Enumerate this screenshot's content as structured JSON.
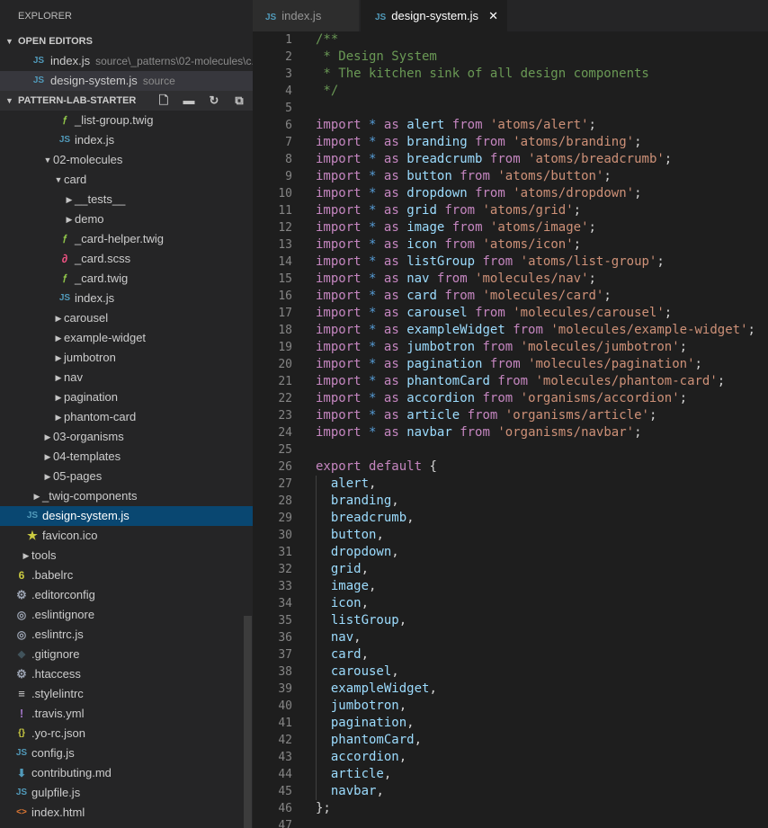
{
  "sidebar": {
    "title": "EXPLORER",
    "open_editors_label": "OPEN EDITORS",
    "open_editors": [
      {
        "icon": "JS",
        "name": "index.js",
        "path": "source\\_patterns\\02-molecules\\c..."
      },
      {
        "icon": "JS",
        "name": "design-system.js",
        "path": "source"
      }
    ],
    "project_label": "PATTERN-LAB-STARTER",
    "tree": [
      {
        "name": "_list-group.twig",
        "type": "twig",
        "depth": 4
      },
      {
        "name": "index.js",
        "type": "js",
        "depth": 4
      },
      {
        "name": "02-molecules",
        "type": "folder-open",
        "depth": 2
      },
      {
        "name": "card",
        "type": "folder-open",
        "depth": 3
      },
      {
        "name": "__tests__",
        "type": "folder",
        "depth": 4
      },
      {
        "name": "demo",
        "type": "folder",
        "depth": 4
      },
      {
        "name": "_card-helper.twig",
        "type": "twig",
        "depth": 4
      },
      {
        "name": "_card.scss",
        "type": "scss",
        "depth": 4
      },
      {
        "name": "_card.twig",
        "type": "twig",
        "depth": 4
      },
      {
        "name": "index.js",
        "type": "js",
        "depth": 4
      },
      {
        "name": "carousel",
        "type": "folder",
        "depth": 3
      },
      {
        "name": "example-widget",
        "type": "folder",
        "depth": 3
      },
      {
        "name": "jumbotron",
        "type": "folder",
        "depth": 3
      },
      {
        "name": "nav",
        "type": "folder",
        "depth": 3
      },
      {
        "name": "pagination",
        "type": "folder",
        "depth": 3
      },
      {
        "name": "phantom-card",
        "type": "folder",
        "depth": 3
      },
      {
        "name": "03-organisms",
        "type": "folder",
        "depth": 2
      },
      {
        "name": "04-templates",
        "type": "folder",
        "depth": 2
      },
      {
        "name": "05-pages",
        "type": "folder",
        "depth": 2
      },
      {
        "name": "_twig-components",
        "type": "folder",
        "depth": 1
      },
      {
        "name": "design-system.js",
        "type": "js",
        "depth": 1,
        "selected": true
      },
      {
        "name": "favicon.ico",
        "type": "star",
        "depth": 1
      },
      {
        "name": "tools",
        "type": "folder",
        "depth": 0
      },
      {
        "name": ".babelrc",
        "type": "babel",
        "depth": 0
      },
      {
        "name": ".editorconfig",
        "type": "gear",
        "depth": 0
      },
      {
        "name": ".eslintignore",
        "type": "eslint",
        "depth": 0
      },
      {
        "name": ".eslintrc.js",
        "type": "eslint",
        "depth": 0
      },
      {
        "name": ".gitignore",
        "type": "git",
        "depth": 0
      },
      {
        "name": ".htaccess",
        "type": "gear",
        "depth": 0
      },
      {
        "name": ".stylelintrc",
        "type": "lines",
        "depth": 0
      },
      {
        "name": ".travis.yml",
        "type": "yml",
        "depth": 0
      },
      {
        "name": ".yo-rc.json",
        "type": "json",
        "depth": 0
      },
      {
        "name": "config.js",
        "type": "js",
        "depth": 0
      },
      {
        "name": "contributing.md",
        "type": "md",
        "depth": 0
      },
      {
        "name": "gulpfile.js",
        "type": "js",
        "depth": 0
      },
      {
        "name": "index.html",
        "type": "html",
        "depth": 0
      }
    ]
  },
  "tabs": [
    {
      "icon": "JS",
      "label": "index.js"
    },
    {
      "icon": "JS",
      "label": "design-system.js",
      "active": true
    }
  ],
  "code": [
    [
      [
        "c",
        "/**"
      ]
    ],
    [
      [
        "c",
        " * Design System"
      ]
    ],
    [
      [
        "c",
        " * The kitchen sink of all design components"
      ]
    ],
    [
      [
        "c",
        " */"
      ]
    ],
    [],
    [
      [
        "k",
        "import"
      ],
      [
        "p",
        " "
      ],
      [
        "b",
        "*"
      ],
      [
        "p",
        " "
      ],
      [
        "k",
        "as"
      ],
      [
        "p",
        " "
      ],
      [
        "v",
        "alert"
      ],
      [
        "p",
        " "
      ],
      [
        "k",
        "from"
      ],
      [
        "p",
        " "
      ],
      [
        "s",
        "'atoms/alert'"
      ],
      [
        "p",
        ";"
      ]
    ],
    [
      [
        "k",
        "import"
      ],
      [
        "p",
        " "
      ],
      [
        "b",
        "*"
      ],
      [
        "p",
        " "
      ],
      [
        "k",
        "as"
      ],
      [
        "p",
        " "
      ],
      [
        "v",
        "branding"
      ],
      [
        "p",
        " "
      ],
      [
        "k",
        "from"
      ],
      [
        "p",
        " "
      ],
      [
        "s",
        "'atoms/branding'"
      ],
      [
        "p",
        ";"
      ]
    ],
    [
      [
        "k",
        "import"
      ],
      [
        "p",
        " "
      ],
      [
        "b",
        "*"
      ],
      [
        "p",
        " "
      ],
      [
        "k",
        "as"
      ],
      [
        "p",
        " "
      ],
      [
        "v",
        "breadcrumb"
      ],
      [
        "p",
        " "
      ],
      [
        "k",
        "from"
      ],
      [
        "p",
        " "
      ],
      [
        "s",
        "'atoms/breadcrumb'"
      ],
      [
        "p",
        ";"
      ]
    ],
    [
      [
        "k",
        "import"
      ],
      [
        "p",
        " "
      ],
      [
        "b",
        "*"
      ],
      [
        "p",
        " "
      ],
      [
        "k",
        "as"
      ],
      [
        "p",
        " "
      ],
      [
        "v",
        "button"
      ],
      [
        "p",
        " "
      ],
      [
        "k",
        "from"
      ],
      [
        "p",
        " "
      ],
      [
        "s",
        "'atoms/button'"
      ],
      [
        "p",
        ";"
      ]
    ],
    [
      [
        "k",
        "import"
      ],
      [
        "p",
        " "
      ],
      [
        "b",
        "*"
      ],
      [
        "p",
        " "
      ],
      [
        "k",
        "as"
      ],
      [
        "p",
        " "
      ],
      [
        "v",
        "dropdown"
      ],
      [
        "p",
        " "
      ],
      [
        "k",
        "from"
      ],
      [
        "p",
        " "
      ],
      [
        "s",
        "'atoms/dropdown'"
      ],
      [
        "p",
        ";"
      ]
    ],
    [
      [
        "k",
        "import"
      ],
      [
        "p",
        " "
      ],
      [
        "b",
        "*"
      ],
      [
        "p",
        " "
      ],
      [
        "k",
        "as"
      ],
      [
        "p",
        " "
      ],
      [
        "v",
        "grid"
      ],
      [
        "p",
        " "
      ],
      [
        "k",
        "from"
      ],
      [
        "p",
        " "
      ],
      [
        "s",
        "'atoms/grid'"
      ],
      [
        "p",
        ";"
      ]
    ],
    [
      [
        "k",
        "import"
      ],
      [
        "p",
        " "
      ],
      [
        "b",
        "*"
      ],
      [
        "p",
        " "
      ],
      [
        "k",
        "as"
      ],
      [
        "p",
        " "
      ],
      [
        "v",
        "image"
      ],
      [
        "p",
        " "
      ],
      [
        "k",
        "from"
      ],
      [
        "p",
        " "
      ],
      [
        "s",
        "'atoms/image'"
      ],
      [
        "p",
        ";"
      ]
    ],
    [
      [
        "k",
        "import"
      ],
      [
        "p",
        " "
      ],
      [
        "b",
        "*"
      ],
      [
        "p",
        " "
      ],
      [
        "k",
        "as"
      ],
      [
        "p",
        " "
      ],
      [
        "v",
        "icon"
      ],
      [
        "p",
        " "
      ],
      [
        "k",
        "from"
      ],
      [
        "p",
        " "
      ],
      [
        "s",
        "'atoms/icon'"
      ],
      [
        "p",
        ";"
      ]
    ],
    [
      [
        "k",
        "import"
      ],
      [
        "p",
        " "
      ],
      [
        "b",
        "*"
      ],
      [
        "p",
        " "
      ],
      [
        "k",
        "as"
      ],
      [
        "p",
        " "
      ],
      [
        "v",
        "listGroup"
      ],
      [
        "p",
        " "
      ],
      [
        "k",
        "from"
      ],
      [
        "p",
        " "
      ],
      [
        "s",
        "'atoms/list-group'"
      ],
      [
        "p",
        ";"
      ]
    ],
    [
      [
        "k",
        "import"
      ],
      [
        "p",
        " "
      ],
      [
        "b",
        "*"
      ],
      [
        "p",
        " "
      ],
      [
        "k",
        "as"
      ],
      [
        "p",
        " "
      ],
      [
        "v",
        "nav"
      ],
      [
        "p",
        " "
      ],
      [
        "k",
        "from"
      ],
      [
        "p",
        " "
      ],
      [
        "s",
        "'molecules/nav'"
      ],
      [
        "p",
        ";"
      ]
    ],
    [
      [
        "k",
        "import"
      ],
      [
        "p",
        " "
      ],
      [
        "b",
        "*"
      ],
      [
        "p",
        " "
      ],
      [
        "k",
        "as"
      ],
      [
        "p",
        " "
      ],
      [
        "v",
        "card"
      ],
      [
        "p",
        " "
      ],
      [
        "k",
        "from"
      ],
      [
        "p",
        " "
      ],
      [
        "s",
        "'molecules/card'"
      ],
      [
        "p",
        ";"
      ]
    ],
    [
      [
        "k",
        "import"
      ],
      [
        "p",
        " "
      ],
      [
        "b",
        "*"
      ],
      [
        "p",
        " "
      ],
      [
        "k",
        "as"
      ],
      [
        "p",
        " "
      ],
      [
        "v",
        "carousel"
      ],
      [
        "p",
        " "
      ],
      [
        "k",
        "from"
      ],
      [
        "p",
        " "
      ],
      [
        "s",
        "'molecules/carousel'"
      ],
      [
        "p",
        ";"
      ]
    ],
    [
      [
        "k",
        "import"
      ],
      [
        "p",
        " "
      ],
      [
        "b",
        "*"
      ],
      [
        "p",
        " "
      ],
      [
        "k",
        "as"
      ],
      [
        "p",
        " "
      ],
      [
        "v",
        "exampleWidget"
      ],
      [
        "p",
        " "
      ],
      [
        "k",
        "from"
      ],
      [
        "p",
        " "
      ],
      [
        "s",
        "'molecules/example-widget'"
      ],
      [
        "p",
        ";"
      ]
    ],
    [
      [
        "k",
        "import"
      ],
      [
        "p",
        " "
      ],
      [
        "b",
        "*"
      ],
      [
        "p",
        " "
      ],
      [
        "k",
        "as"
      ],
      [
        "p",
        " "
      ],
      [
        "v",
        "jumbotron"
      ],
      [
        "p",
        " "
      ],
      [
        "k",
        "from"
      ],
      [
        "p",
        " "
      ],
      [
        "s",
        "'molecules/jumbotron'"
      ],
      [
        "p",
        ";"
      ]
    ],
    [
      [
        "k",
        "import"
      ],
      [
        "p",
        " "
      ],
      [
        "b",
        "*"
      ],
      [
        "p",
        " "
      ],
      [
        "k",
        "as"
      ],
      [
        "p",
        " "
      ],
      [
        "v",
        "pagination"
      ],
      [
        "p",
        " "
      ],
      [
        "k",
        "from"
      ],
      [
        "p",
        " "
      ],
      [
        "s",
        "'molecules/pagination'"
      ],
      [
        "p",
        ";"
      ]
    ],
    [
      [
        "k",
        "import"
      ],
      [
        "p",
        " "
      ],
      [
        "b",
        "*"
      ],
      [
        "p",
        " "
      ],
      [
        "k",
        "as"
      ],
      [
        "p",
        " "
      ],
      [
        "v",
        "phantomCard"
      ],
      [
        "p",
        " "
      ],
      [
        "k",
        "from"
      ],
      [
        "p",
        " "
      ],
      [
        "s",
        "'molecules/phantom-card'"
      ],
      [
        "p",
        ";"
      ]
    ],
    [
      [
        "k",
        "import"
      ],
      [
        "p",
        " "
      ],
      [
        "b",
        "*"
      ],
      [
        "p",
        " "
      ],
      [
        "k",
        "as"
      ],
      [
        "p",
        " "
      ],
      [
        "v",
        "accordion"
      ],
      [
        "p",
        " "
      ],
      [
        "k",
        "from"
      ],
      [
        "p",
        " "
      ],
      [
        "s",
        "'organisms/accordion'"
      ],
      [
        "p",
        ";"
      ]
    ],
    [
      [
        "k",
        "import"
      ],
      [
        "p",
        " "
      ],
      [
        "b",
        "*"
      ],
      [
        "p",
        " "
      ],
      [
        "k",
        "as"
      ],
      [
        "p",
        " "
      ],
      [
        "v",
        "article"
      ],
      [
        "p",
        " "
      ],
      [
        "k",
        "from"
      ],
      [
        "p",
        " "
      ],
      [
        "s",
        "'organisms/article'"
      ],
      [
        "p",
        ";"
      ]
    ],
    [
      [
        "k",
        "import"
      ],
      [
        "p",
        " "
      ],
      [
        "b",
        "*"
      ],
      [
        "p",
        " "
      ],
      [
        "k",
        "as"
      ],
      [
        "p",
        " "
      ],
      [
        "v",
        "navbar"
      ],
      [
        "p",
        " "
      ],
      [
        "k",
        "from"
      ],
      [
        "p",
        " "
      ],
      [
        "s",
        "'organisms/navbar'"
      ],
      [
        "p",
        ";"
      ]
    ],
    [],
    [
      [
        "k",
        "export"
      ],
      [
        "p",
        " "
      ],
      [
        "k",
        "default"
      ],
      [
        "p",
        " {"
      ]
    ],
    [
      [
        "p",
        "  "
      ],
      [
        "v",
        "alert"
      ],
      [
        "p",
        ","
      ]
    ],
    [
      [
        "p",
        "  "
      ],
      [
        "v",
        "branding"
      ],
      [
        "p",
        ","
      ]
    ],
    [
      [
        "p",
        "  "
      ],
      [
        "v",
        "breadcrumb"
      ],
      [
        "p",
        ","
      ]
    ],
    [
      [
        "p",
        "  "
      ],
      [
        "v",
        "button"
      ],
      [
        "p",
        ","
      ]
    ],
    [
      [
        "p",
        "  "
      ],
      [
        "v",
        "dropdown"
      ],
      [
        "p",
        ","
      ]
    ],
    [
      [
        "p",
        "  "
      ],
      [
        "v",
        "grid"
      ],
      [
        "p",
        ","
      ]
    ],
    [
      [
        "p",
        "  "
      ],
      [
        "v",
        "image"
      ],
      [
        "p",
        ","
      ]
    ],
    [
      [
        "p",
        "  "
      ],
      [
        "v",
        "icon"
      ],
      [
        "p",
        ","
      ]
    ],
    [
      [
        "p",
        "  "
      ],
      [
        "v",
        "listGroup"
      ],
      [
        "p",
        ","
      ]
    ],
    [
      [
        "p",
        "  "
      ],
      [
        "v",
        "nav"
      ],
      [
        "p",
        ","
      ]
    ],
    [
      [
        "p",
        "  "
      ],
      [
        "v",
        "card"
      ],
      [
        "p",
        ","
      ]
    ],
    [
      [
        "p",
        "  "
      ],
      [
        "v",
        "carousel"
      ],
      [
        "p",
        ","
      ]
    ],
    [
      [
        "p",
        "  "
      ],
      [
        "v",
        "exampleWidget"
      ],
      [
        "p",
        ","
      ]
    ],
    [
      [
        "p",
        "  "
      ],
      [
        "v",
        "jumbotron"
      ],
      [
        "p",
        ","
      ]
    ],
    [
      [
        "p",
        "  "
      ],
      [
        "v",
        "pagination"
      ],
      [
        "p",
        ","
      ]
    ],
    [
      [
        "p",
        "  "
      ],
      [
        "v",
        "phantomCard"
      ],
      [
        "p",
        ","
      ]
    ],
    [
      [
        "p",
        "  "
      ],
      [
        "v",
        "accordion"
      ],
      [
        "p",
        ","
      ]
    ],
    [
      [
        "p",
        "  "
      ],
      [
        "v",
        "article"
      ],
      [
        "p",
        ","
      ]
    ],
    [
      [
        "p",
        "  "
      ],
      [
        "v",
        "navbar"
      ],
      [
        "p",
        ","
      ]
    ],
    [
      [
        "p",
        "};"
      ]
    ],
    []
  ],
  "colors": {
    "keyword": "#c586c0",
    "string": "#ce9178",
    "comment": "#6a9955",
    "operator": "#569cd6",
    "variable": "#9cdcfe",
    "selection": "#094771",
    "js_icon": "#519aba"
  }
}
